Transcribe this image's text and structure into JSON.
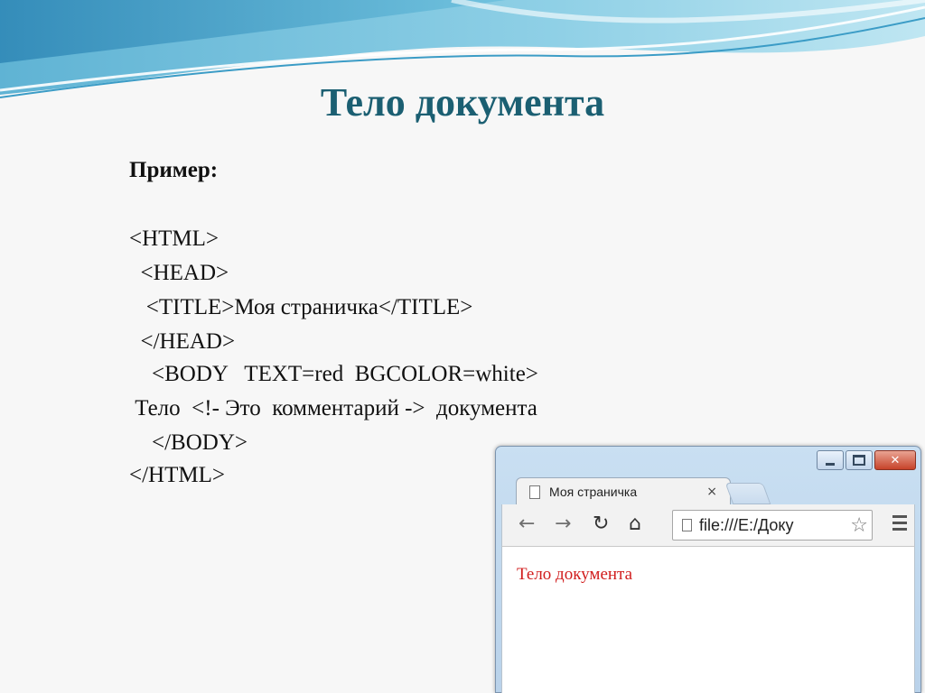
{
  "slide": {
    "title": "Тело документа",
    "example_label": "Пример:",
    "code_lines": [
      "<HTML>",
      "  <HEAD>",
      "   <TITLE>Моя страничка</TITLE>",
      "  </HEAD>",
      "    <BODY   TEXT=red  BGCOLOR=white>",
      " Тело  <!- Это  комментарий ->  документа",
      "    </BODY>",
      "</HTML>"
    ]
  },
  "browser": {
    "tab_title": "Моя страничка",
    "tab_close": "×",
    "address": "file:///E:/Доку",
    "page_text": "Тело документа",
    "colors": {
      "page_text": "#d11d1d",
      "title": "#1b5f72"
    },
    "icons": [
      "back-arrow-icon",
      "forward-arrow-icon",
      "reload-icon",
      "home-icon",
      "page-icon",
      "star-icon",
      "menu-icon",
      "minimize-icon",
      "maximize-icon",
      "close-icon"
    ]
  }
}
